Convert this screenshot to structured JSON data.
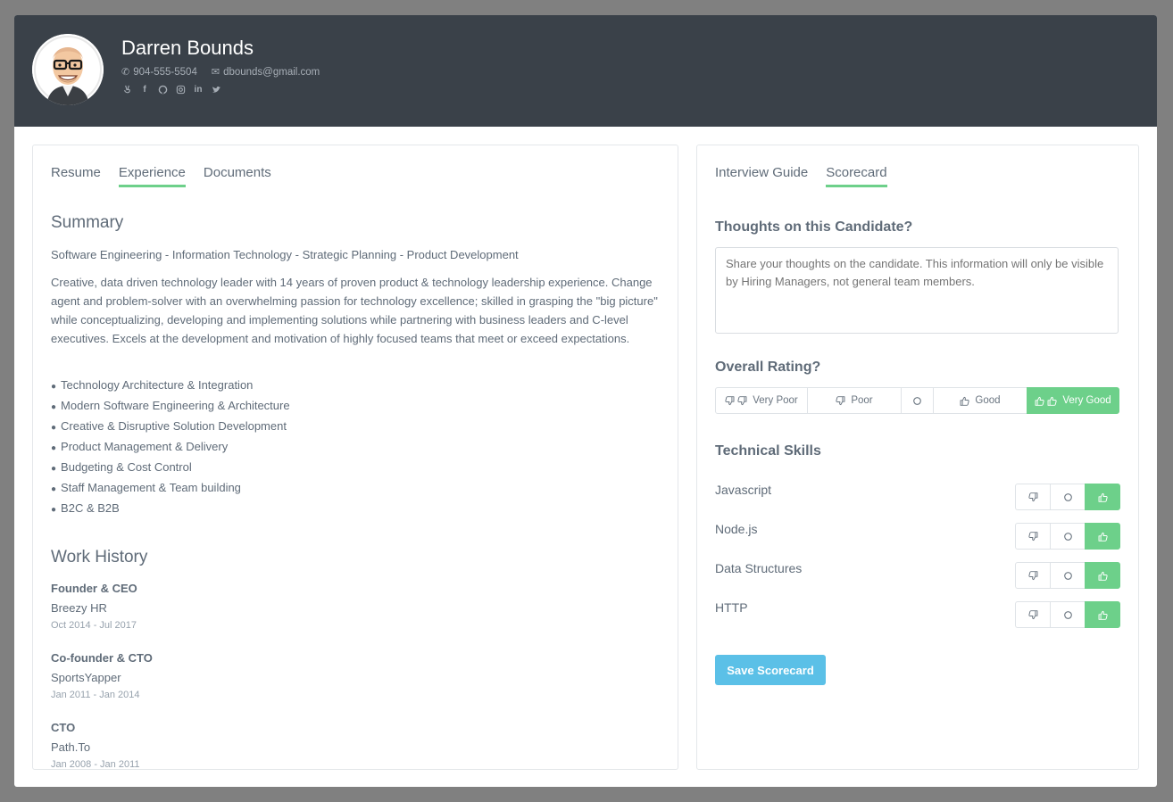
{
  "candidate": {
    "name": "Darren Bounds",
    "phone": "904-555-5504",
    "email": "dbounds@gmail.com",
    "social_icons": [
      "angellist-icon",
      "facebook-icon",
      "github-icon",
      "instagram-icon",
      "linkedin-icon",
      "twitter-icon"
    ]
  },
  "left_panel": {
    "tabs": [
      {
        "label": "Resume",
        "active": false
      },
      {
        "label": "Experience",
        "active": true
      },
      {
        "label": "Documents",
        "active": false
      }
    ],
    "summary": {
      "heading": "Summary",
      "tagline": "Software Engineering - Information Technology - Strategic Planning - Product Development",
      "body": "Creative, data driven technology leader with 14 years of proven product & technology leadership experience. Change agent and problem-solver with an overwhelming passion for technology excellence; skilled in grasping the \"big picture\" while conceptualizing, developing and implementing solutions while partnering with business leaders and C-level executives. Excels at the development and motivation of highly focused teams that meet or exceed expectations.",
      "skills": [
        "Technology Architecture & Integration",
        "Modern Software Engineering & Architecture",
        "Creative & Disruptive Solution Development",
        "Product Management & Delivery",
        "Budgeting & Cost Control",
        "Staff Management & Team building",
        "B2C & B2B"
      ]
    },
    "work_history": {
      "heading": "Work History",
      "jobs": [
        {
          "title": "Founder & CEO",
          "company": "Breezy HR",
          "dates": "Oct 2014 - Jul 2017"
        },
        {
          "title": "Co-founder & CTO",
          "company": "SportsYapper",
          "dates": "Jan 2011 - Jan 2014"
        },
        {
          "title": "CTO",
          "company": "Path.To",
          "dates": "Jan 2008 - Jan 2011"
        }
      ]
    }
  },
  "right_panel": {
    "tabs": [
      {
        "label": "Interview Guide",
        "active": false
      },
      {
        "label": "Scorecard",
        "active": true
      }
    ],
    "thoughts": {
      "heading": "Thoughts on this Candidate?",
      "placeholder": "Share your thoughts on the candidate. This information will only be visible by Hiring Managers, not general team members."
    },
    "overall_rating": {
      "heading": "Overall Rating?",
      "options": [
        {
          "label": "Very Poor",
          "icon": "double-thumbs-down-icon"
        },
        {
          "label": "Poor",
          "icon": "thumbs-down-icon"
        },
        {
          "label": "",
          "icon": "neutral-circle-icon"
        },
        {
          "label": "Good",
          "icon": "thumbs-up-icon"
        },
        {
          "label": "Very Good",
          "icon": "double-thumbs-up-icon"
        }
      ],
      "selected": "Very Good"
    },
    "technical_skills": {
      "heading": "Technical Skills",
      "skills": [
        {
          "name": "Javascript",
          "rating": "thumbs-up"
        },
        {
          "name": "Node.js",
          "rating": "thumbs-up"
        },
        {
          "name": "Data Structures",
          "rating": "thumbs-up"
        },
        {
          "name": "HTTP",
          "rating": "thumbs-up"
        }
      ]
    },
    "save_label": "Save Scorecard"
  },
  "colors": {
    "header_bg": "#3a4149",
    "accent_green": "#6dd08a",
    "button_blue": "#5bc0e7",
    "overlay": "#808080"
  }
}
